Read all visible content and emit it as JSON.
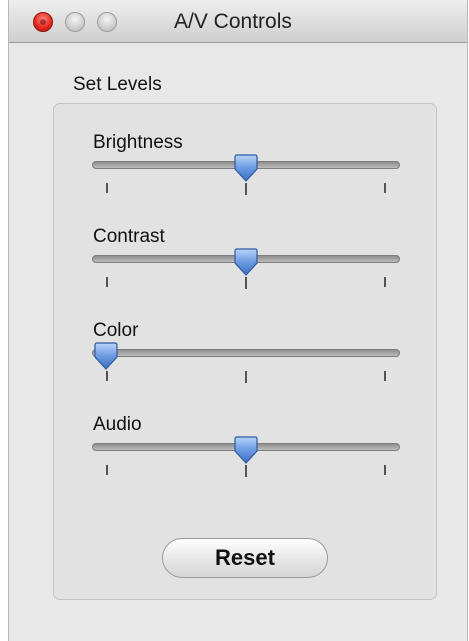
{
  "window": {
    "title": "A/V Controls",
    "buttons": [
      "close",
      "minimize",
      "zoom"
    ]
  },
  "group": {
    "label": "Set Levels"
  },
  "sliders": [
    {
      "label": "Brightness",
      "value": 0.5
    },
    {
      "label": "Contrast",
      "value": 0.5
    },
    {
      "label": "Color",
      "value": 0.0
    },
    {
      "label": "Audio",
      "value": 0.5
    }
  ],
  "reset_label": "Reset",
  "colors": {
    "thumb": "#6b9be0",
    "close_button": "#e3231b"
  }
}
